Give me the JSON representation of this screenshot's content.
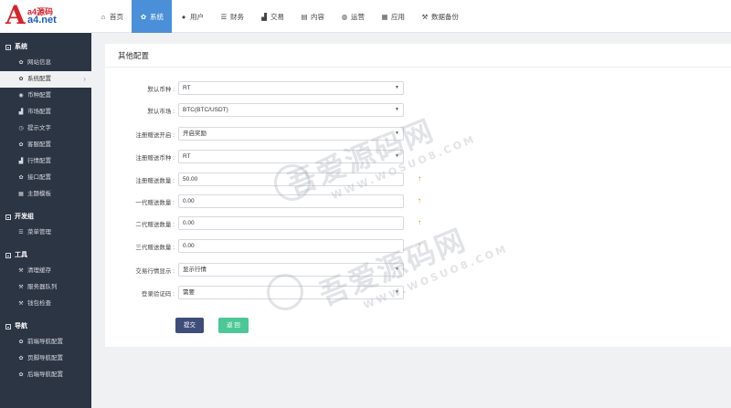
{
  "logo": {
    "letter": "A",
    "line1": "a4源码",
    "line2": "a4.net"
  },
  "sidebar": {
    "groups": [
      {
        "title": "系统",
        "items": [
          {
            "label": "网站信息",
            "icon": "gear-icon"
          },
          {
            "label": "系统配置",
            "icon": "gear-icon",
            "active": true
          },
          {
            "label": "币种配置",
            "icon": "coin-icon"
          },
          {
            "label": "市场配置",
            "icon": "bar-chart-icon"
          },
          {
            "label": "提示文字",
            "icon": "clock-icon"
          },
          {
            "label": "客服配置",
            "icon": "gear-icon"
          },
          {
            "label": "行情配置",
            "icon": "bar-chart-icon"
          },
          {
            "label": "接口配置",
            "icon": "gear-icon"
          },
          {
            "label": "主题模板",
            "icon": "grid-icon"
          }
        ]
      },
      {
        "title": "开发组",
        "items": [
          {
            "label": "菜单管理",
            "icon": "list-icon"
          }
        ]
      },
      {
        "title": "工具",
        "items": [
          {
            "label": "清理缓存",
            "icon": "wrench-icon"
          },
          {
            "label": "服务器队列",
            "icon": "wrench-icon"
          },
          {
            "label": "钱包检查",
            "icon": "wrench-icon"
          }
        ]
      },
      {
        "title": "导航",
        "items": [
          {
            "label": "前端导航配置",
            "icon": "gear-icon"
          },
          {
            "label": "页脚导航配置",
            "icon": "gear-icon"
          },
          {
            "label": "后端导航配置",
            "icon": "gear-icon"
          }
        ]
      }
    ]
  },
  "topbar": {
    "tabs": [
      {
        "label": "首页",
        "icon": "home-icon"
      },
      {
        "label": "系统",
        "icon": "gear-icon",
        "active": true
      },
      {
        "label": "用户",
        "icon": "user-icon"
      },
      {
        "label": "财务",
        "icon": "list-icon"
      },
      {
        "label": "交易",
        "icon": "bar-chart-icon"
      },
      {
        "label": "内容",
        "icon": "document-icon"
      },
      {
        "label": "运营",
        "icon": "globe-icon"
      },
      {
        "label": "应用",
        "icon": "grid-icon"
      },
      {
        "label": "数据备份",
        "icon": "wrench-icon"
      }
    ]
  },
  "panel": {
    "title": "其他配置",
    "fields": [
      {
        "label": "默认币种 :",
        "value": "RT",
        "type": "select"
      },
      {
        "label": "默认市场 :",
        "value": "BTC(BTC/USDT)",
        "type": "select"
      },
      {
        "label": "注册赠送开启 :",
        "value": "开启奖励",
        "type": "select"
      },
      {
        "label": "注册赠送币种 :",
        "value": "RT",
        "type": "select"
      },
      {
        "label": "注册赠送数量 :",
        "value": "50.00",
        "type": "input",
        "hint": "↑"
      },
      {
        "label": "一代赠送数量 :",
        "value": "0.00",
        "type": "input",
        "hint": "↑"
      },
      {
        "label": "二代赠送数量 :",
        "value": "0.00",
        "type": "input",
        "hint": "↑"
      },
      {
        "label": "三代赠送数量 :",
        "value": "0.00",
        "type": "input",
        "hint": "↑"
      },
      {
        "label": "交易行情显示 :",
        "value": "显示行情",
        "type": "select"
      },
      {
        "label": "登录验证码 :",
        "value": "需要",
        "type": "select"
      }
    ],
    "submit_label": "提交",
    "back_label": "返 回"
  },
  "watermark": {
    "text": "吾爱源码网",
    "url": "WWW.WOSUO8.COM"
  },
  "colors": {
    "sidebar_bg": "#2c3544",
    "accent": "#4a8fd8",
    "submit": "#3e4d7a",
    "back": "#4cc896",
    "hint": "#c47a1c"
  }
}
